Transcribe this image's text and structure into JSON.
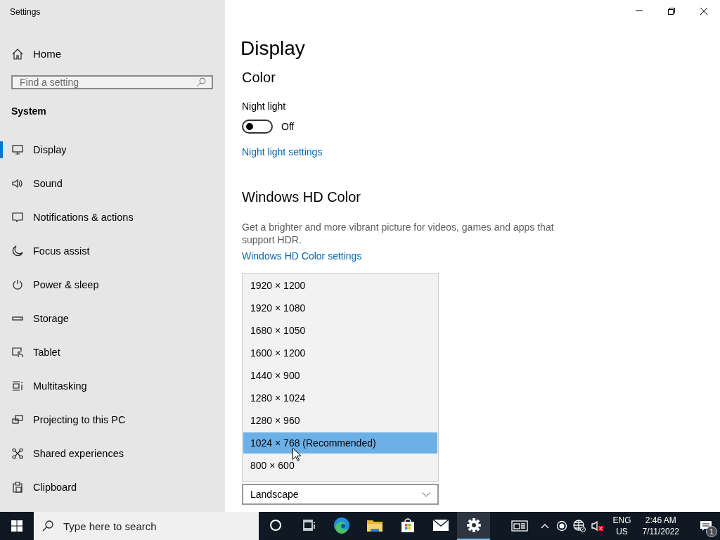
{
  "window": {
    "title": "Settings"
  },
  "sidebar": {
    "home": "Home",
    "search": {
      "placeholder": "Find a setting"
    },
    "section": "System",
    "items": [
      {
        "label": "Display",
        "selected": true
      },
      {
        "label": "Sound",
        "selected": false
      },
      {
        "label": "Notifications & actions",
        "selected": false
      },
      {
        "label": "Focus assist",
        "selected": false
      },
      {
        "label": "Power & sleep",
        "selected": false
      },
      {
        "label": "Storage",
        "selected": false
      },
      {
        "label": "Tablet",
        "selected": false
      },
      {
        "label": "Multitasking",
        "selected": false
      },
      {
        "label": "Projecting to this PC",
        "selected": false
      },
      {
        "label": "Shared experiences",
        "selected": false
      },
      {
        "label": "Clipboard",
        "selected": false
      }
    ]
  },
  "main": {
    "title": "Display",
    "color_heading": "Color",
    "night_light": {
      "label": "Night light",
      "on": false,
      "state_text": "Off"
    },
    "night_light_link": "Night light settings",
    "hd_heading": "Windows HD Color",
    "hd_description": "Get a brighter and more vibrant picture for videos, games and apps that support HDR.",
    "hd_link": "Windows HD Color settings",
    "orientation": {
      "value": "Landscape"
    }
  },
  "resolution_menu": {
    "options": [
      {
        "label": "1920 × 1200",
        "selected": false
      },
      {
        "label": "1920 × 1080",
        "selected": false
      },
      {
        "label": "1680 × 1050",
        "selected": false
      },
      {
        "label": "1600 × 1200",
        "selected": false
      },
      {
        "label": "1440 × 900",
        "selected": false
      },
      {
        "label": "1280 × 1024",
        "selected": false
      },
      {
        "label": "1280 × 960",
        "selected": false
      },
      {
        "label": "1024 × 768 (Recommended)",
        "selected": true
      },
      {
        "label": "800 × 600",
        "selected": false
      }
    ]
  },
  "taskbar": {
    "search": {
      "placeholder": "Type here to search"
    },
    "apps": [
      {
        "active": false
      },
      {
        "active": false
      },
      {
        "active": false
      },
      {
        "active": false
      },
      {
        "active": false
      },
      {
        "active": false
      },
      {
        "active": true
      }
    ],
    "tray": {
      "language": "ENG",
      "region": "US",
      "time": "2:46 AM",
      "date": "7/11/2022",
      "notification_count": "1"
    }
  }
}
